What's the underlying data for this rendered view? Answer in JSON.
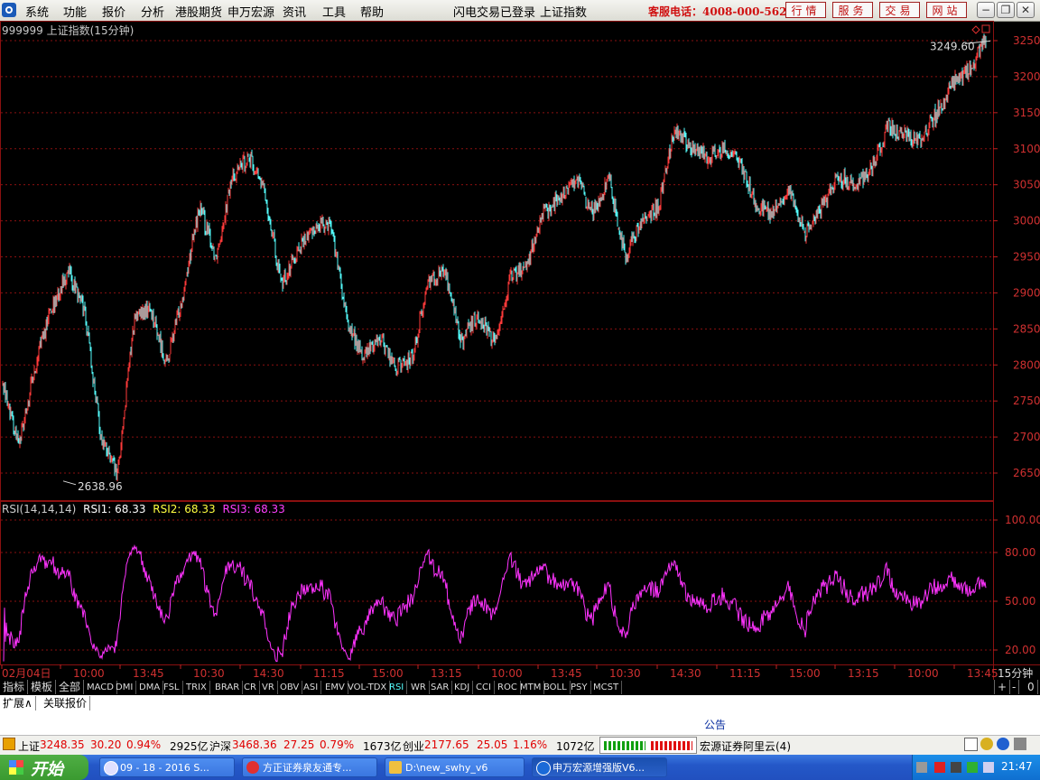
{
  "menu": {
    "items": [
      "系统",
      "功能",
      "报价",
      "分析",
      "港股期货",
      "申万宏源",
      "资讯",
      "工具",
      "帮助"
    ],
    "login_status": "闪电交易已登录",
    "current_symbol": "上证指数",
    "hotline": "客服电话：4008-000-562",
    "nav_buttons": [
      "行情",
      "服务",
      "交易",
      "网站"
    ]
  },
  "chart": {
    "title": "999999 上证指数(15分钟)",
    "high_label": "3249.60",
    "low_label": "2638.96",
    "price_axis_ticks": [
      "3250",
      "3200",
      "3150",
      "3100",
      "3050",
      "3000",
      "2950",
      "2900",
      "2850",
      "2800",
      "2750",
      "2700",
      "2650"
    ],
    "rsi_axis_ticks": [
      "100.00",
      "80.00",
      "50.00",
      "20.00"
    ],
    "time_axis_labels": [
      "02月04日",
      "10:00",
      "13:45",
      "10:30",
      "14:30",
      "11:15",
      "15:00",
      "13:15",
      "10:00",
      "13:45",
      "10:30",
      "14:30",
      "11:15",
      "15:00",
      "13:15",
      "10:00",
      "13:45"
    ],
    "period_label": "15分钟",
    "colors": {
      "up": "#ff3a3a",
      "down": "#54fcfc",
      "rsi": "#ff33ff",
      "grid": "#8a1010"
    }
  },
  "chart_data": [
    {
      "type": "candlestick",
      "title": "999999 上证指数(15分钟)",
      "ylim": [
        2620,
        3265
      ],
      "y_ticks": [
        2650,
        2700,
        2750,
        2800,
        2850,
        2900,
        2950,
        3000,
        3050,
        3100,
        3150,
        3200,
        3250
      ],
      "x": [
        "02月04日",
        "10:00",
        "13:45",
        "10:30",
        "14:30",
        "11:15",
        "15:00",
        "13:15",
        "10:00",
        "13:45",
        "10:30",
        "14:30",
        "11:15",
        "15:00",
        "13:15",
        "10:00",
        "13:45"
      ],
      "close_path": [
        2775,
        2690,
        2800,
        2880,
        2930,
        2870,
        2700,
        2645,
        2860,
        2880,
        2800,
        2900,
        3020,
        2950,
        3060,
        3090,
        3040,
        2910,
        2960,
        2990,
        3000,
        2860,
        2810,
        2840,
        2795,
        2810,
        2920,
        2930,
        2830,
        2870,
        2830,
        2920,
        2940,
        3010,
        3030,
        3060,
        3010,
        3060,
        2950,
        3000,
        3020,
        3130,
        3100,
        3090,
        3100,
        3080,
        3020,
        3010,
        3040,
        2980,
        3020,
        3060,
        3050,
        3070,
        3130,
        3120,
        3110,
        3150,
        3190,
        3210,
        3249.6
      ],
      "high": 3249.6,
      "low": 2638.96
    },
    {
      "type": "line",
      "title": "RSI(14,14,14)",
      "ylim": [
        13,
        103
      ],
      "y_ticks": [
        20,
        50,
        80,
        100
      ],
      "series": [
        {
          "name": "RSI1",
          "last": 68.33
        },
        {
          "name": "RSI2",
          "last": 68.33
        },
        {
          "name": "RSI3",
          "last": 68.33
        }
      ]
    }
  ],
  "rsi_legend": {
    "name": "RSI(14,14,14)",
    "rsi1": "RSI1: 68.33",
    "rsi2": "RSI2: 68.33",
    "rsi3": "RSI3: 68.33"
  },
  "left_tabs": [
    "指标",
    "模板",
    "全部"
  ],
  "indicator_tabs": [
    "MACD",
    "DMI",
    "DMA",
    "FSL",
    "TRIX",
    "BRAR",
    "CR",
    "VR",
    "OBV",
    "ASI",
    "EMV",
    "VOL-TDX",
    "RSI",
    "WR",
    "SAR",
    "KDJ",
    "CCI",
    "ROC",
    "MTM",
    "BOLL",
    "PSY",
    "MCST"
  ],
  "active_indicator": "RSI",
  "zoom_buttons": [
    "+",
    "-",
    "0"
  ],
  "ext_tabs": [
    "扩展∧",
    "关联报价"
  ],
  "announcement": "公告",
  "status": {
    "sh_label": "上证",
    "sh_val": "3248.35",
    "sh_chg": "30.20",
    "sh_pct": "0.94%",
    "sh_amt": "2925亿",
    "hs_label": "沪深",
    "hs_val": "3468.36",
    "hs_chg": "27.25",
    "hs_pct": "0.79%",
    "hs_amt": "1673亿",
    "cy_label": "创业",
    "cy_val": "2177.65",
    "cy_chg": "25.05",
    "cy_pct": "1.16%",
    "cy_amt": "1072亿",
    "server": "宏源证券阿里云(4)"
  },
  "taskbar": {
    "start": "开始",
    "tasks": [
      "09 - 18 - 2016 S...",
      "方正证券泉友通专...",
      "D:\\new_swhy_v6",
      "申万宏源增强版V6..."
    ],
    "clock": "21:47"
  }
}
